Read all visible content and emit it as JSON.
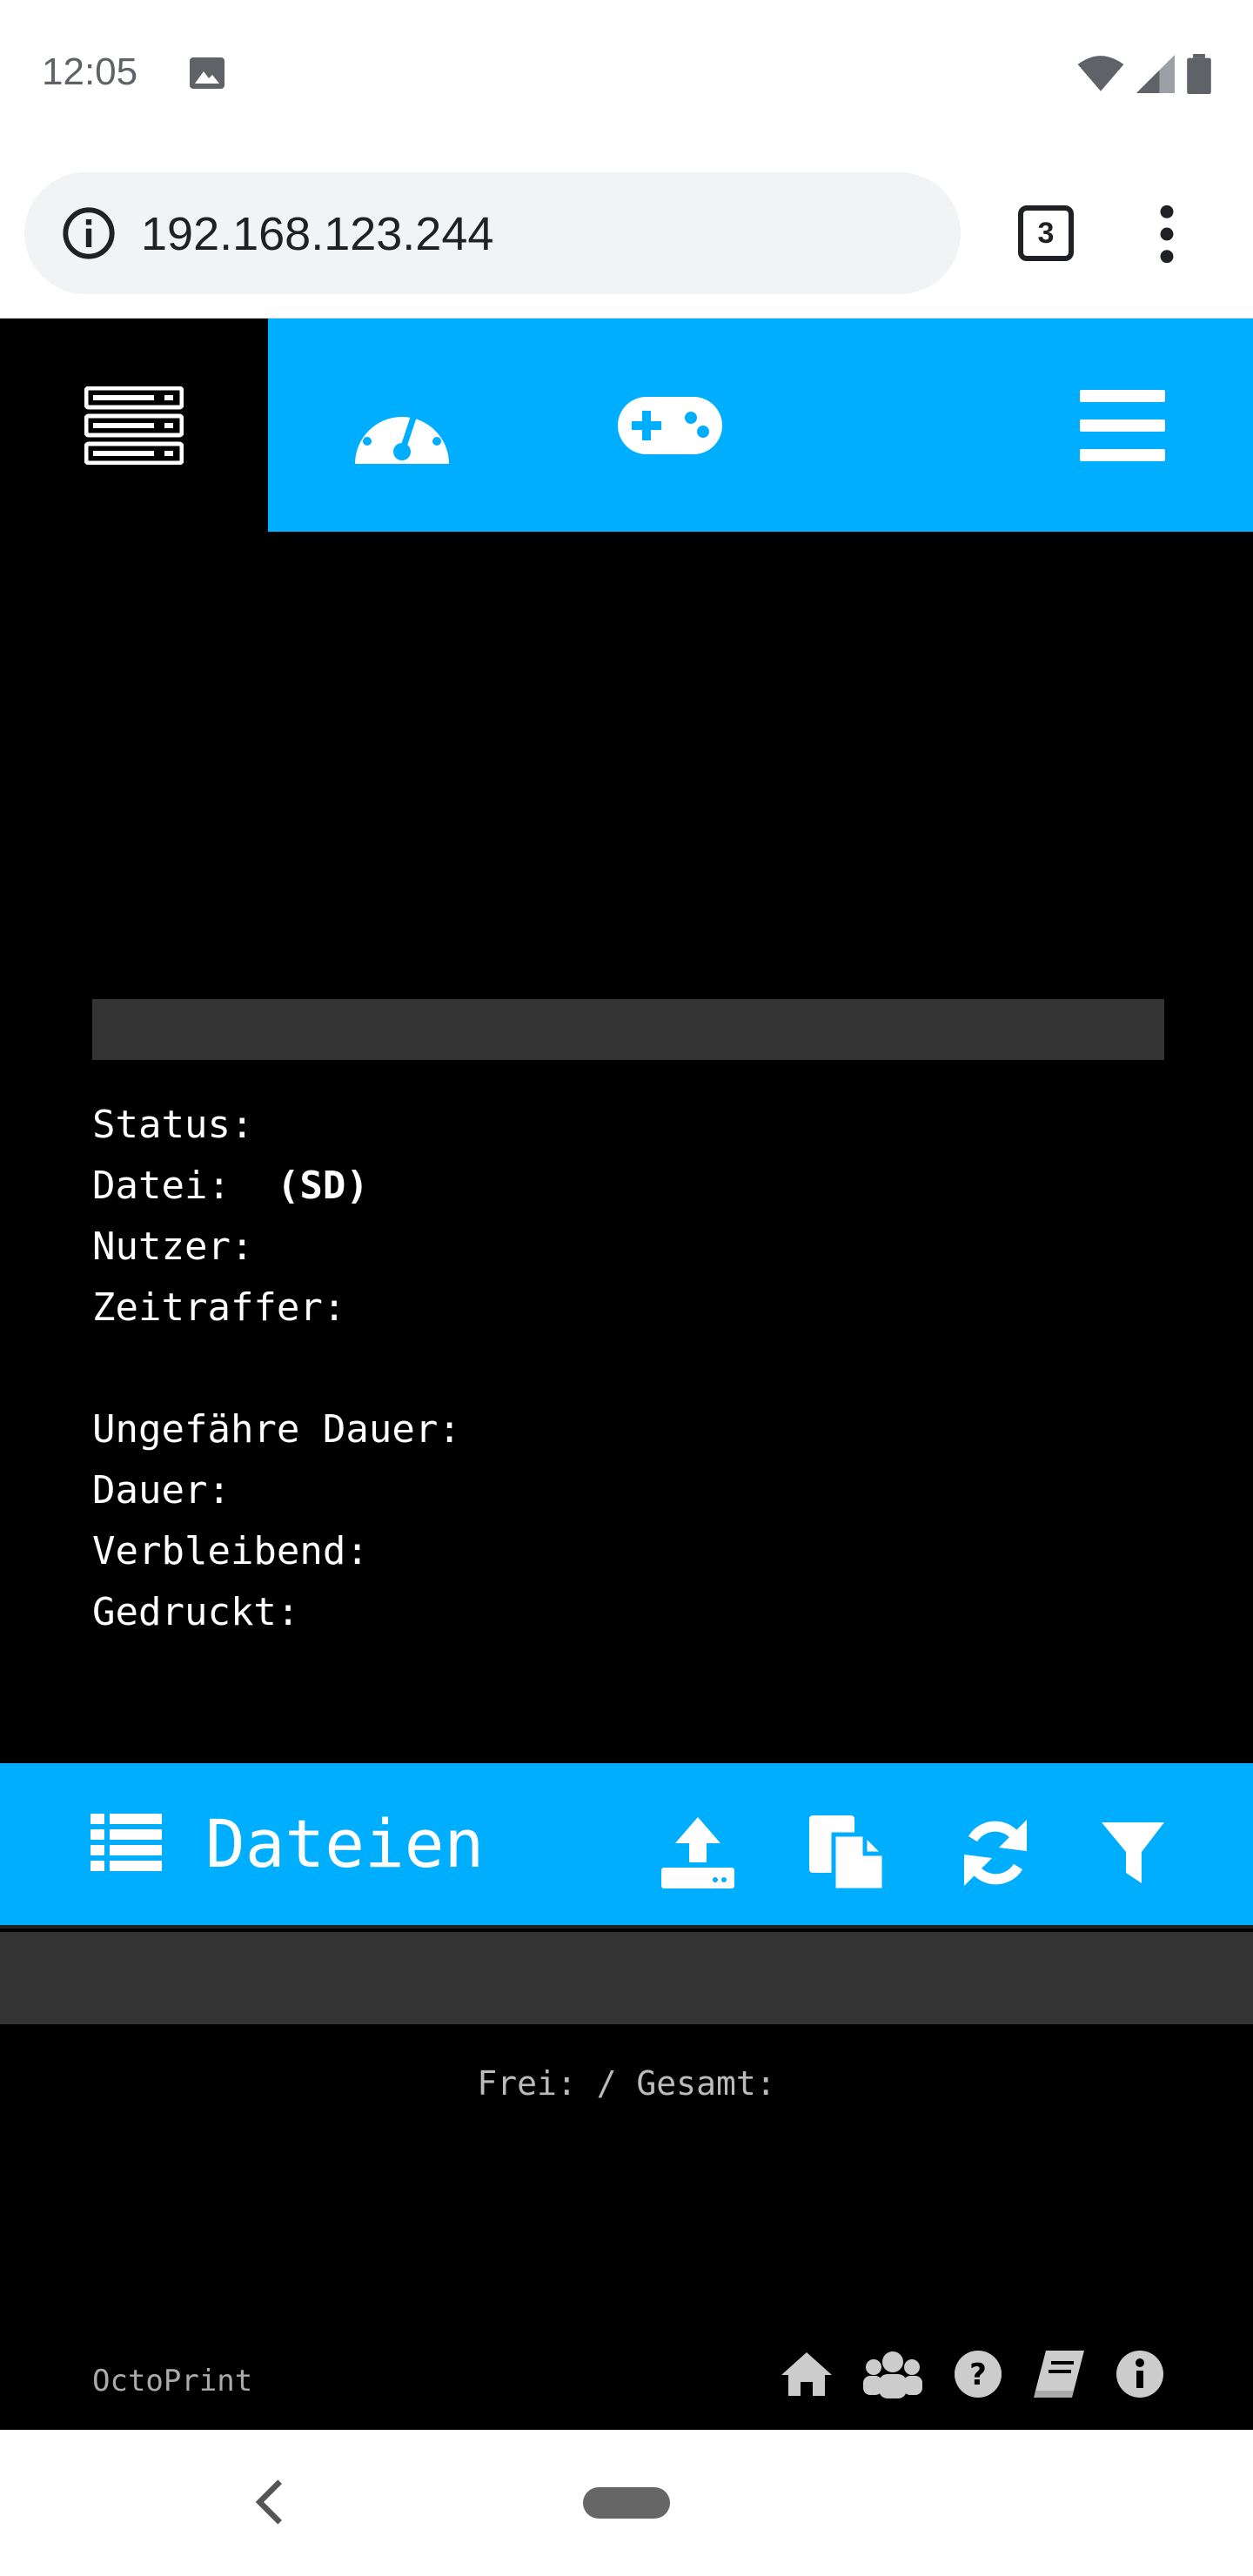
{
  "status_bar": {
    "time": "12:05",
    "icons": [
      "image-icon",
      "wifi-icon",
      "signal-icon",
      "battery-icon"
    ]
  },
  "browser": {
    "url": "192.168.123.244",
    "tab_count": "3",
    "icons": [
      "info-icon",
      "overflow-menu-icon"
    ]
  },
  "topnav": {
    "tabs": [
      {
        "icon": "server-icon",
        "active": true
      },
      {
        "icon": "dashboard-gauge-icon",
        "active": false
      },
      {
        "icon": "gamepad-icon",
        "active": false
      },
      {
        "icon": "hamburger-menu-icon",
        "active": false
      }
    ],
    "colors": {
      "accent": "#00aeff",
      "active_bg": "#000000"
    }
  },
  "progress": {
    "value": 0
  },
  "state": {
    "status_label": "Status:",
    "status_value": "",
    "file_label": "Datei:",
    "file_value": "(SD)",
    "user_label": "Nutzer:",
    "timelapse_label": "Zeitraffer:",
    "approx_time_label": "Ungefähre Dauer:",
    "time_label": "Dauer:",
    "remaining_label": "Verbleibend:",
    "printed_label": "Gedruckt:"
  },
  "files": {
    "title": "Dateien",
    "toolbar_icons": [
      "upload-icon",
      "sd-copy-icon",
      "refresh-icon",
      "filter-icon"
    ],
    "free_space_text": "Frei: / Gesamt:"
  },
  "footer": {
    "brand": "OctoPrint",
    "links": [
      "home-icon",
      "community-icon",
      "help-icon",
      "docs-book-icon",
      "about-info-icon"
    ]
  }
}
